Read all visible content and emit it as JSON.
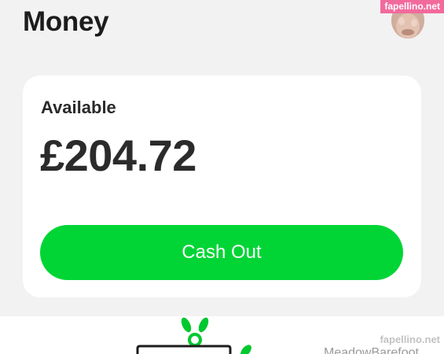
{
  "header": {
    "title": "Money",
    "avatar_icon": "profile-avatar"
  },
  "watermark": {
    "text": "fapellino.net"
  },
  "balance_card": {
    "label": "Available",
    "amount": "£204.72",
    "cash_out_label": "Cash Out"
  },
  "promo": {
    "label": "MeadowBarefoot",
    "illustration_icon": "plant-sprout-icon"
  },
  "corner_watermark": {
    "text": "fapellino.net"
  },
  "colors": {
    "background": "#f2f2f2",
    "card": "#ffffff",
    "accent_green": "#00d535",
    "text_dark": "#1c1c1c",
    "watermark_pink": "#f26a9c"
  }
}
